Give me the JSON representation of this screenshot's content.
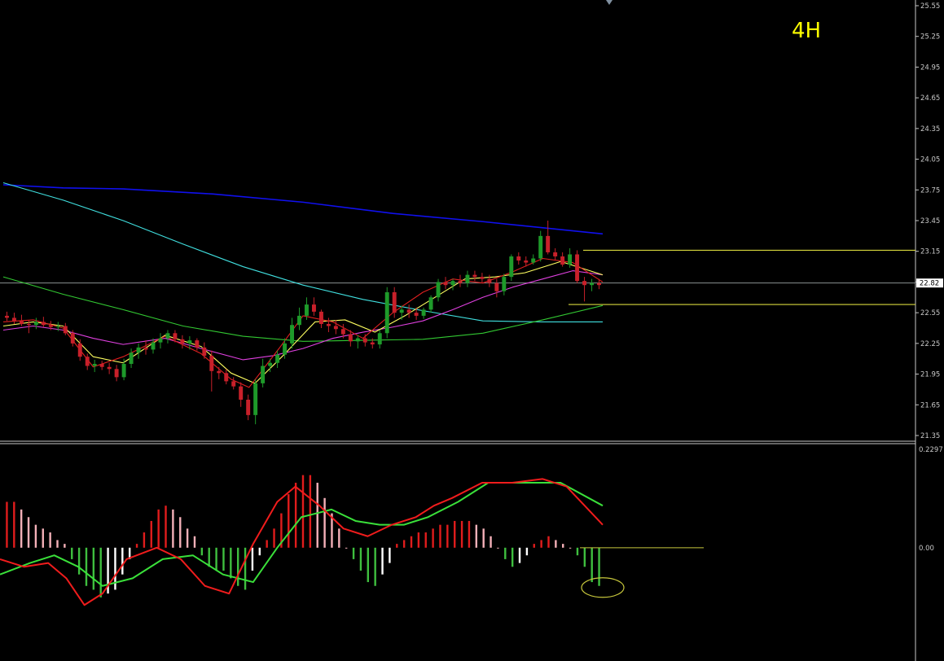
{
  "chart_data": {
    "type": "candlestick",
    "timeframe_label": "4H",
    "price_axis": {
      "ylim": [
        21.35,
        25.55
      ],
      "ticks": [
        "25.55",
        "25.25",
        "24.95",
        "24.65",
        "24.35",
        "24.05",
        "23.75",
        "23.45",
        "23.15",
        "22.85",
        "22.55",
        "22.25",
        "21.95",
        "21.65",
        "21.35"
      ],
      "current_price_label": "22.82",
      "current_price": 22.84
    },
    "oscillator_axis": {
      "ylim": [
        -0.19,
        0.2297
      ],
      "top_label": "0.2297",
      "zero_label": "0.00"
    },
    "horizontal_levels": [
      23.16,
      22.63
    ],
    "oscillator_level": 0.0,
    "candles": [
      [
        22.52,
        22.56,
        22.47,
        22.5
      ],
      [
        22.5,
        22.55,
        22.44,
        22.47
      ],
      [
        22.47,
        22.53,
        22.42,
        22.44
      ],
      [
        22.44,
        22.48,
        22.35,
        22.43
      ],
      [
        22.43,
        22.5,
        22.39,
        22.46
      ],
      [
        22.46,
        22.51,
        22.41,
        22.43
      ],
      [
        22.43,
        22.47,
        22.38,
        22.41
      ],
      [
        22.41,
        22.46,
        22.37,
        22.42
      ],
      [
        22.42,
        22.45,
        22.33,
        22.35
      ],
      [
        22.35,
        22.38,
        22.22,
        22.25
      ],
      [
        22.25,
        22.29,
        22.08,
        22.12
      ],
      [
        22.12,
        22.15,
        21.99,
        22.03
      ],
      [
        22.03,
        22.09,
        21.97,
        22.05
      ],
      [
        22.05,
        22.08,
        21.99,
        22.02
      ],
      [
        22.02,
        22.06,
        21.95,
        22.0
      ],
      [
        22.0,
        22.04,
        21.88,
        21.92
      ],
      [
        21.92,
        22.1,
        21.89,
        22.05
      ],
      [
        22.05,
        22.2,
        22.01,
        22.16
      ],
      [
        22.16,
        22.25,
        22.1,
        22.21
      ],
      [
        22.21,
        22.28,
        22.14,
        22.19
      ],
      [
        22.19,
        22.3,
        22.15,
        22.26
      ],
      [
        22.26,
        22.35,
        22.2,
        22.3
      ],
      [
        22.3,
        22.38,
        22.25,
        22.35
      ],
      [
        22.35,
        22.38,
        22.26,
        22.29
      ],
      [
        22.29,
        22.33,
        22.2,
        22.25
      ],
      [
        22.25,
        22.32,
        22.19,
        22.28
      ],
      [
        22.28,
        22.3,
        22.18,
        22.21
      ],
      [
        22.21,
        22.26,
        22.1,
        22.13
      ],
      [
        22.13,
        22.18,
        21.78,
        21.98
      ],
      [
        21.98,
        22.02,
        21.9,
        21.96
      ],
      [
        21.96,
        22.0,
        21.85,
        21.88
      ],
      [
        21.88,
        21.92,
        21.8,
        21.83
      ],
      [
        21.83,
        21.87,
        21.63,
        21.7
      ],
      [
        21.7,
        21.75,
        21.5,
        21.55
      ],
      [
        21.55,
        21.9,
        21.46,
        21.86
      ],
      [
        21.86,
        22.1,
        21.82,
        22.03
      ],
      [
        22.03,
        22.1,
        21.97,
        22.06
      ],
      [
        22.06,
        22.18,
        22.01,
        22.14
      ],
      [
        22.14,
        22.3,
        22.1,
        22.25
      ],
      [
        22.25,
        22.5,
        22.2,
        22.43
      ],
      [
        22.43,
        22.6,
        22.38,
        22.52
      ],
      [
        22.52,
        22.7,
        22.48,
        22.63
      ],
      [
        22.63,
        22.7,
        22.52,
        22.56
      ],
      [
        22.56,
        22.58,
        22.4,
        22.44
      ],
      [
        22.44,
        22.5,
        22.36,
        22.42
      ],
      [
        22.42,
        22.48,
        22.34,
        22.39
      ],
      [
        22.39,
        22.44,
        22.3,
        22.34
      ],
      [
        22.34,
        22.38,
        22.22,
        22.27
      ],
      [
        22.27,
        22.33,
        22.2,
        22.3
      ],
      [
        22.3,
        22.34,
        22.22,
        22.26
      ],
      [
        22.26,
        22.3,
        22.2,
        22.24
      ],
      [
        22.24,
        22.38,
        22.2,
        22.35
      ],
      [
        22.35,
        22.8,
        22.3,
        22.75
      ],
      [
        22.75,
        22.8,
        22.5,
        22.55
      ],
      [
        22.55,
        22.62,
        22.48,
        22.58
      ],
      [
        22.58,
        22.63,
        22.5,
        22.55
      ],
      [
        22.55,
        22.6,
        22.48,
        22.52
      ],
      [
        22.52,
        22.6,
        22.49,
        22.58
      ],
      [
        22.58,
        22.72,
        22.55,
        22.7
      ],
      [
        22.7,
        22.88,
        22.66,
        22.85
      ],
      [
        22.85,
        22.9,
        22.78,
        22.82
      ],
      [
        22.82,
        22.88,
        22.77,
        22.86
      ],
      [
        22.86,
        22.92,
        22.8,
        22.84
      ],
      [
        22.84,
        22.96,
        22.8,
        22.92
      ],
      [
        22.92,
        22.96,
        22.86,
        22.9
      ],
      [
        22.9,
        22.94,
        22.84,
        22.88
      ],
      [
        22.88,
        22.92,
        22.8,
        22.84
      ],
      [
        22.84,
        22.88,
        22.7,
        22.76
      ],
      [
        22.76,
        22.93,
        22.72,
        22.9
      ],
      [
        22.9,
        23.12,
        22.86,
        23.1
      ],
      [
        23.1,
        23.14,
        23.02,
        23.06
      ],
      [
        23.06,
        23.1,
        23.0,
        23.04
      ],
      [
        23.04,
        23.12,
        23.02,
        23.08
      ],
      [
        23.08,
        23.35,
        23.05,
        23.3
      ],
      [
        23.3,
        23.45,
        23.12,
        23.14
      ],
      [
        23.14,
        23.18,
        23.06,
        23.1
      ],
      [
        23.1,
        23.14,
        23.0,
        23.02
      ],
      [
        23.02,
        23.18,
        22.99,
        23.12
      ],
      [
        23.12,
        23.16,
        22.84,
        22.86
      ],
      [
        22.86,
        22.9,
        22.66,
        22.82
      ],
      [
        22.82,
        22.88,
        22.76,
        22.84
      ],
      [
        22.84,
        22.88,
        22.78,
        22.82
      ]
    ],
    "series": [
      {
        "name": "",
        "color": "#1010ee",
        "points": [
          [
            0,
            23.8
          ],
          [
            0.1,
            23.77
          ],
          [
            0.2,
            23.76
          ],
          [
            0.35,
            23.71
          ],
          [
            0.5,
            23.63
          ],
          [
            0.65,
            23.52
          ],
          [
            0.8,
            23.44
          ],
          [
            1,
            23.32
          ]
        ]
      },
      {
        "name": "",
        "color": "#40e0e0",
        "points": [
          [
            0,
            23.82
          ],
          [
            0.1,
            23.65
          ],
          [
            0.2,
            23.45
          ],
          [
            0.3,
            23.22
          ],
          [
            0.4,
            23.0
          ],
          [
            0.5,
            22.82
          ],
          [
            0.6,
            22.68
          ],
          [
            0.7,
            22.57
          ],
          [
            0.8,
            22.47
          ],
          [
            0.9,
            22.46
          ],
          [
            1,
            22.46
          ]
        ]
      },
      {
        "name": "",
        "color": "#32c832",
        "points": [
          [
            0,
            22.9
          ],
          [
            0.1,
            22.73
          ],
          [
            0.2,
            22.58
          ],
          [
            0.3,
            22.42
          ],
          [
            0.4,
            22.32
          ],
          [
            0.5,
            22.27
          ],
          [
            0.6,
            22.28
          ],
          [
            0.7,
            22.29
          ],
          [
            0.8,
            22.35
          ],
          [
            0.9,
            22.48
          ],
          [
            1,
            22.62
          ]
        ]
      },
      {
        "name": "",
        "color": "#e040e0",
        "points": [
          [
            0,
            22.38
          ],
          [
            0.05,
            22.42
          ],
          [
            0.1,
            22.38
          ],
          [
            0.15,
            22.3
          ],
          [
            0.2,
            22.24
          ],
          [
            0.27,
            22.3
          ],
          [
            0.33,
            22.2
          ],
          [
            0.4,
            22.09
          ],
          [
            0.45,
            22.13
          ],
          [
            0.5,
            22.2
          ],
          [
            0.55,
            22.3
          ],
          [
            0.6,
            22.36
          ],
          [
            0.65,
            22.41
          ],
          [
            0.7,
            22.47
          ],
          [
            0.75,
            22.58
          ],
          [
            0.8,
            22.7
          ],
          [
            0.85,
            22.8
          ],
          [
            0.9,
            22.88
          ],
          [
            0.95,
            22.96
          ],
          [
            1,
            22.92
          ]
        ]
      },
      {
        "name": "",
        "color": "#ffff60",
        "points": [
          [
            0,
            22.42
          ],
          [
            0.05,
            22.46
          ],
          [
            0.1,
            22.42
          ],
          [
            0.15,
            22.12
          ],
          [
            0.2,
            22.06
          ],
          [
            0.27,
            22.33
          ],
          [
            0.33,
            22.22
          ],
          [
            0.38,
            21.96
          ],
          [
            0.42,
            21.86
          ],
          [
            0.47,
            22.15
          ],
          [
            0.52,
            22.46
          ],
          [
            0.57,
            22.48
          ],
          [
            0.62,
            22.36
          ],
          [
            0.67,
            22.52
          ],
          [
            0.72,
            22.7
          ],
          [
            0.77,
            22.88
          ],
          [
            0.82,
            22.9
          ],
          [
            0.87,
            22.94
          ],
          [
            0.93,
            23.05
          ],
          [
            1,
            22.92
          ]
        ]
      },
      {
        "name": "",
        "color": "#e02020",
        "points": [
          [
            0,
            22.46
          ],
          [
            0.05,
            22.48
          ],
          [
            0.1,
            22.4
          ],
          [
            0.15,
            22.02
          ],
          [
            0.2,
            22.12
          ],
          [
            0.27,
            22.32
          ],
          [
            0.33,
            22.15
          ],
          [
            0.38,
            21.9
          ],
          [
            0.41,
            21.82
          ],
          [
            0.46,
            22.2
          ],
          [
            0.5,
            22.52
          ],
          [
            0.55,
            22.46
          ],
          [
            0.6,
            22.3
          ],
          [
            0.65,
            22.55
          ],
          [
            0.7,
            22.75
          ],
          [
            0.75,
            22.88
          ],
          [
            0.8,
            22.84
          ],
          [
            0.85,
            22.95
          ],
          [
            0.9,
            23.08
          ],
          [
            0.95,
            23.04
          ],
          [
            1,
            22.85
          ]
        ]
      }
    ],
    "oscillator": {
      "histogram": [
        0.12,
        0.12,
        0.1,
        0.08,
        0.06,
        0.05,
        0.04,
        0.02,
        0.01,
        -0.03,
        -0.07,
        -0.1,
        -0.11,
        -0.13,
        -0.12,
        -0.11,
        -0.07,
        -0.03,
        0.01,
        0.04,
        0.07,
        0.1,
        0.11,
        0.1,
        0.08,
        0.05,
        0.03,
        -0.02,
        -0.05,
        -0.06,
        -0.06,
        -0.08,
        -0.1,
        -0.11,
        -0.06,
        -0.02,
        0.02,
        0.05,
        0.09,
        0.14,
        0.17,
        0.19,
        0.19,
        0.17,
        0.13,
        0.09,
        0.05,
        0.0,
        -0.03,
        -0.06,
        -0.09,
        -0.1,
        -0.07,
        -0.04,
        0.01,
        0.02,
        0.03,
        0.04,
        0.04,
        0.05,
        0.06,
        0.06,
        0.07,
        0.07,
        0.07,
        0.06,
        0.05,
        0.03,
        0.0,
        -0.03,
        -0.05,
        -0.04,
        -0.02,
        0.01,
        0.02,
        0.03,
        0.02,
        0.01,
        0.0,
        -0.02,
        -0.05,
        -0.09,
        -0.1
      ],
      "macd_line": [
        [
          0,
          -0.03
        ],
        [
          0.04,
          -0.05
        ],
        [
          0.08,
          -0.04
        ],
        [
          0.11,
          -0.08
        ],
        [
          0.14,
          -0.15
        ],
        [
          0.17,
          -0.12
        ],
        [
          0.21,
          -0.03
        ],
        [
          0.26,
          0.0
        ],
        [
          0.3,
          -0.03
        ],
        [
          0.34,
          -0.1
        ],
        [
          0.38,
          -0.12
        ],
        [
          0.42,
          0.01
        ],
        [
          0.46,
          0.12
        ],
        [
          0.49,
          0.16
        ],
        [
          0.53,
          0.11
        ],
        [
          0.57,
          0.05
        ],
        [
          0.61,
          0.03
        ],
        [
          0.65,
          0.06
        ],
        [
          0.69,
          0.08
        ],
        [
          0.72,
          0.11
        ],
        [
          0.75,
          0.13
        ],
        [
          0.8,
          0.17
        ],
        [
          0.85,
          0.17
        ],
        [
          0.9,
          0.18
        ],
        [
          0.94,
          0.16
        ],
        [
          1,
          0.06
        ]
      ],
      "signal_line": [
        [
          0,
          -0.07
        ],
        [
          0.05,
          -0.04
        ],
        [
          0.09,
          -0.02
        ],
        [
          0.13,
          -0.05
        ],
        [
          0.17,
          -0.1
        ],
        [
          0.22,
          -0.08
        ],
        [
          0.27,
          -0.03
        ],
        [
          0.32,
          -0.02
        ],
        [
          0.37,
          -0.07
        ],
        [
          0.42,
          -0.09
        ],
        [
          0.46,
          0.0
        ],
        [
          0.5,
          0.08
        ],
        [
          0.55,
          0.1
        ],
        [
          0.59,
          0.07
        ],
        [
          0.63,
          0.06
        ],
        [
          0.67,
          0.06
        ],
        [
          0.71,
          0.08
        ],
        [
          0.76,
          0.12
        ],
        [
          0.81,
          0.17
        ],
        [
          0.87,
          0.17
        ],
        [
          0.93,
          0.17
        ],
        [
          1,
          0.11
        ]
      ]
    }
  }
}
